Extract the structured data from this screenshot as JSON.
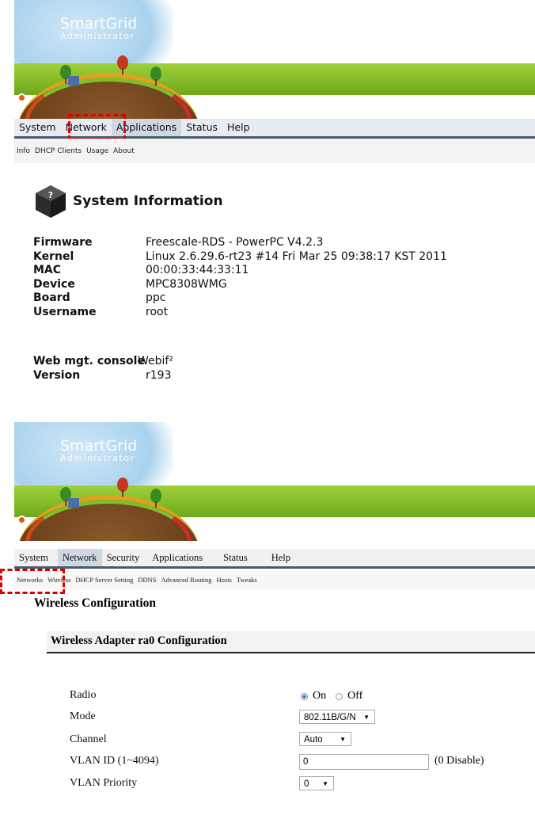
{
  "app": {
    "logo_line1": "SmartGrid",
    "logo_line2": "Administrator"
  },
  "panel1": {
    "menu": [
      "System",
      "Network",
      "Applications",
      "Status",
      "Help"
    ],
    "submenu": [
      "Info",
      "DHCP Clients",
      "Usage",
      "About"
    ],
    "page_title": "System Information",
    "info": [
      {
        "label": "Firmware",
        "value": "Freescale-RDS - PowerPC V4.2.3"
      },
      {
        "label": "Kernel",
        "value": "Linux 2.6.29.6-rt23 #14 Fri Mar 25 09:38:17 KST 2011"
      },
      {
        "label": "MAC",
        "value": "00:00:33:44:33:11"
      },
      {
        "label": "Device",
        "value": "MPC8308WMG"
      },
      {
        "label": "Board",
        "value": "ppc"
      },
      {
        "label": "Username",
        "value": "root"
      }
    ],
    "console_label": "Web mgt. console",
    "console_value": "Webif²",
    "version_label": "Version",
    "version_value": "r193"
  },
  "panel2": {
    "menu": [
      "System",
      "Network",
      "Security",
      "Applications",
      "Status",
      "Help"
    ],
    "submenu": [
      "Networks",
      "Wireless",
      "DHCP Server Setting",
      "DDNS",
      "Advanced Routing",
      "Hosts",
      "Tweaks"
    ],
    "page_title": "Wireless Configuration",
    "section_title": "Wireless Adapter ra0 Configuration",
    "fields": {
      "radio_label": "Radio",
      "radio_on": "On",
      "radio_off": "Off",
      "mode_label": "Mode",
      "mode_value": "802.11B/G/N",
      "channel_label": "Channel",
      "channel_value": "Auto",
      "vlan_id_label": "VLAN ID (1~4094)",
      "vlan_id_value": "0",
      "vlan_id_hint": "(0 Disable)",
      "vlan_priority_label": "VLAN Priority",
      "vlan_priority_value": "0"
    }
  },
  "colors": {
    "highlight": "#e00000",
    "header_green": "#8cc63f",
    "menu_bg": "#e6ecf2"
  }
}
